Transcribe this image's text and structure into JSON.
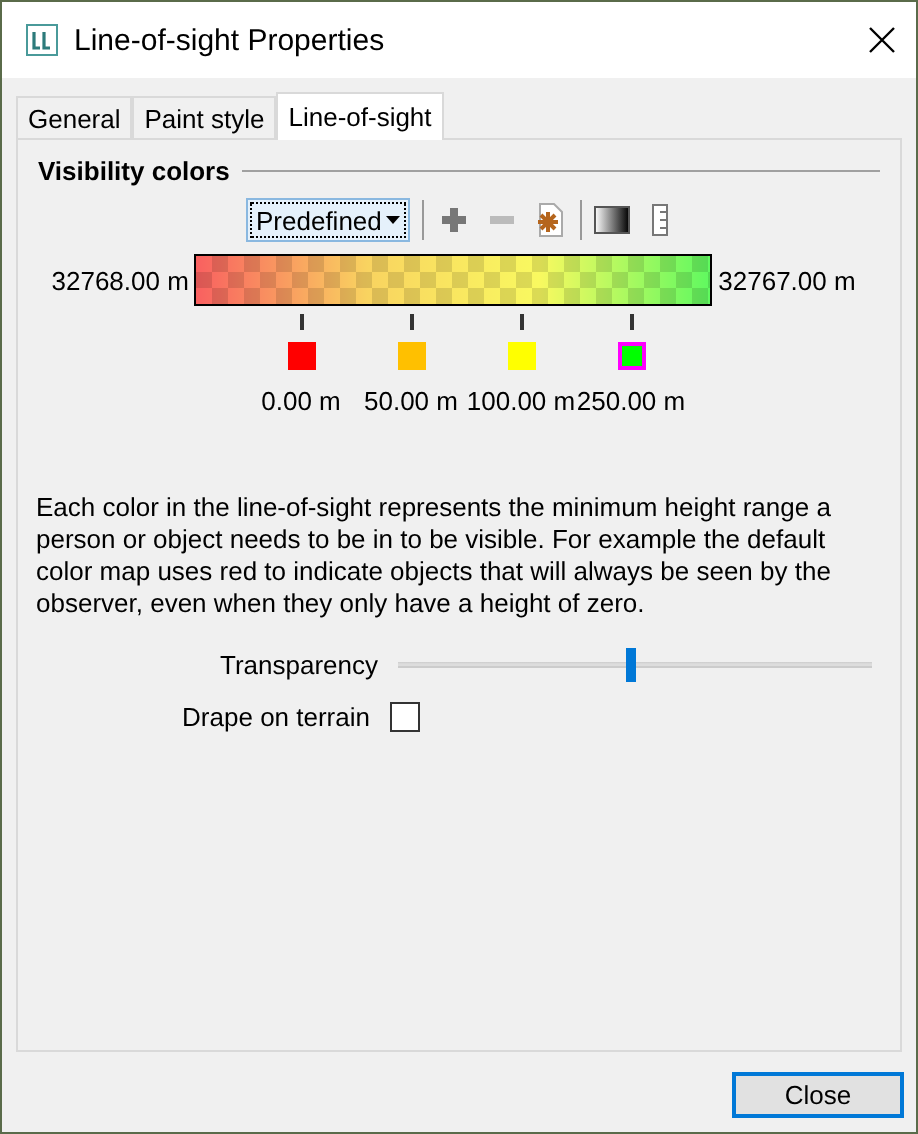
{
  "window": {
    "title": "Line-of-sight Properties"
  },
  "tabs": [
    {
      "label": "General",
      "selected": false
    },
    {
      "label": "Paint style",
      "selected": false
    },
    {
      "label": "Line-of-sight",
      "selected": true
    }
  ],
  "section": {
    "title": "Visibility colors"
  },
  "toolbar": {
    "dropdown": "Predefined"
  },
  "ramp": {
    "min_label": "32768.00 m",
    "max_label": "32767.00 m"
  },
  "stops": [
    {
      "label": "0.00 m",
      "color": "#ff0000",
      "selected": false
    },
    {
      "label": "50.00 m",
      "color": "#ffc000",
      "selected": false
    },
    {
      "label": "100.00 m",
      "color": "#ffff00",
      "selected": false
    },
    {
      "label": "250.00 m",
      "color": "#00ff00",
      "selected": true
    }
  ],
  "description": "Each color in the line-of-sight represents the minimum height range a person or object needs to be in to be visible. For example the default color map uses red to indicate objects that will always be seen by the observer, even when they only have a height of zero.",
  "transparency": {
    "label": "Transparency",
    "level": 0.49
  },
  "drape": {
    "label": "Drape on terrain",
    "checked": false
  },
  "buttons": {
    "close": "Close"
  }
}
